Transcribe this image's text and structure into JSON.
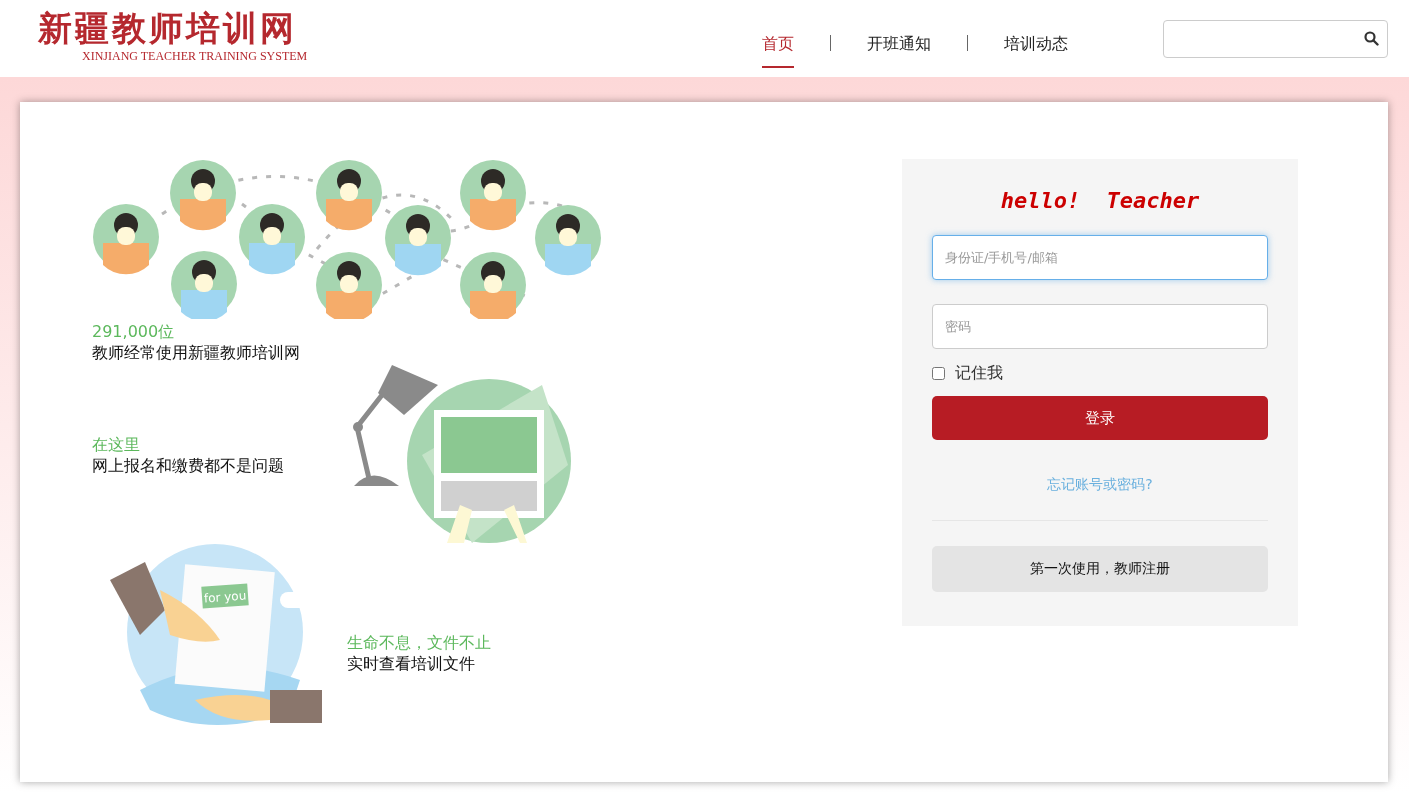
{
  "logo": {
    "title": "新疆教师培训网",
    "subtitle": "XINJIANG TEACHER TRAINING SYSTEM"
  },
  "nav": [
    {
      "label": "首页",
      "selected": true
    },
    {
      "label": "开班通知",
      "selected": false
    },
    {
      "label": "培训动态",
      "selected": false
    }
  ],
  "features": [
    {
      "kind": "people",
      "highlight": "291,000位",
      "text": "教师经常使用新疆教师培训网"
    },
    {
      "kind": "laptop",
      "highlight": "在这里",
      "text": "网上报名和缴费都不是问题"
    },
    {
      "kind": "documents",
      "highlight": "生命不息，文件不止",
      "text": "实时查看培训文件",
      "badge": "for you"
    }
  ],
  "login": {
    "greeting": "hello!  Teacher",
    "account": {
      "placeholder": "身份证/手机号/邮箱",
      "focused": true
    },
    "password": {
      "placeholder": "密码",
      "focused": false
    },
    "remember": {
      "label": "记住我",
      "checked": false
    },
    "submit": "登录",
    "forgot": "忘记账号或密码?",
    "register": "第一次使用，教师注册"
  }
}
